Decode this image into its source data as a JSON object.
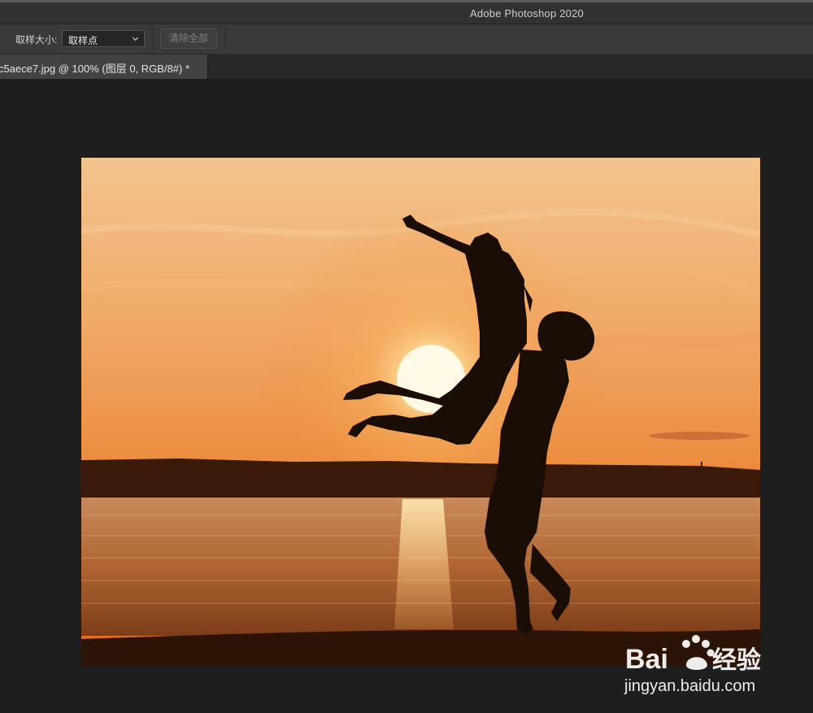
{
  "window": {
    "title": "Adobe Photoshop 2020"
  },
  "options_bar": {
    "sample_size_label": "取样大小:",
    "sample_size_value": "取样点",
    "clear_all_label": "清除全部"
  },
  "document_tab": {
    "label": "c5aece7.jpg @ 100% (图层 0, RGB/8#) *"
  },
  "watermark": {
    "brand": "Bai 经验",
    "url": "jingyan.baidu.com"
  },
  "colors": {
    "sky_top": "#f3c48e",
    "sun": "#fff6d8",
    "water": "#c2753d",
    "silhouette": "#1a0d06"
  }
}
